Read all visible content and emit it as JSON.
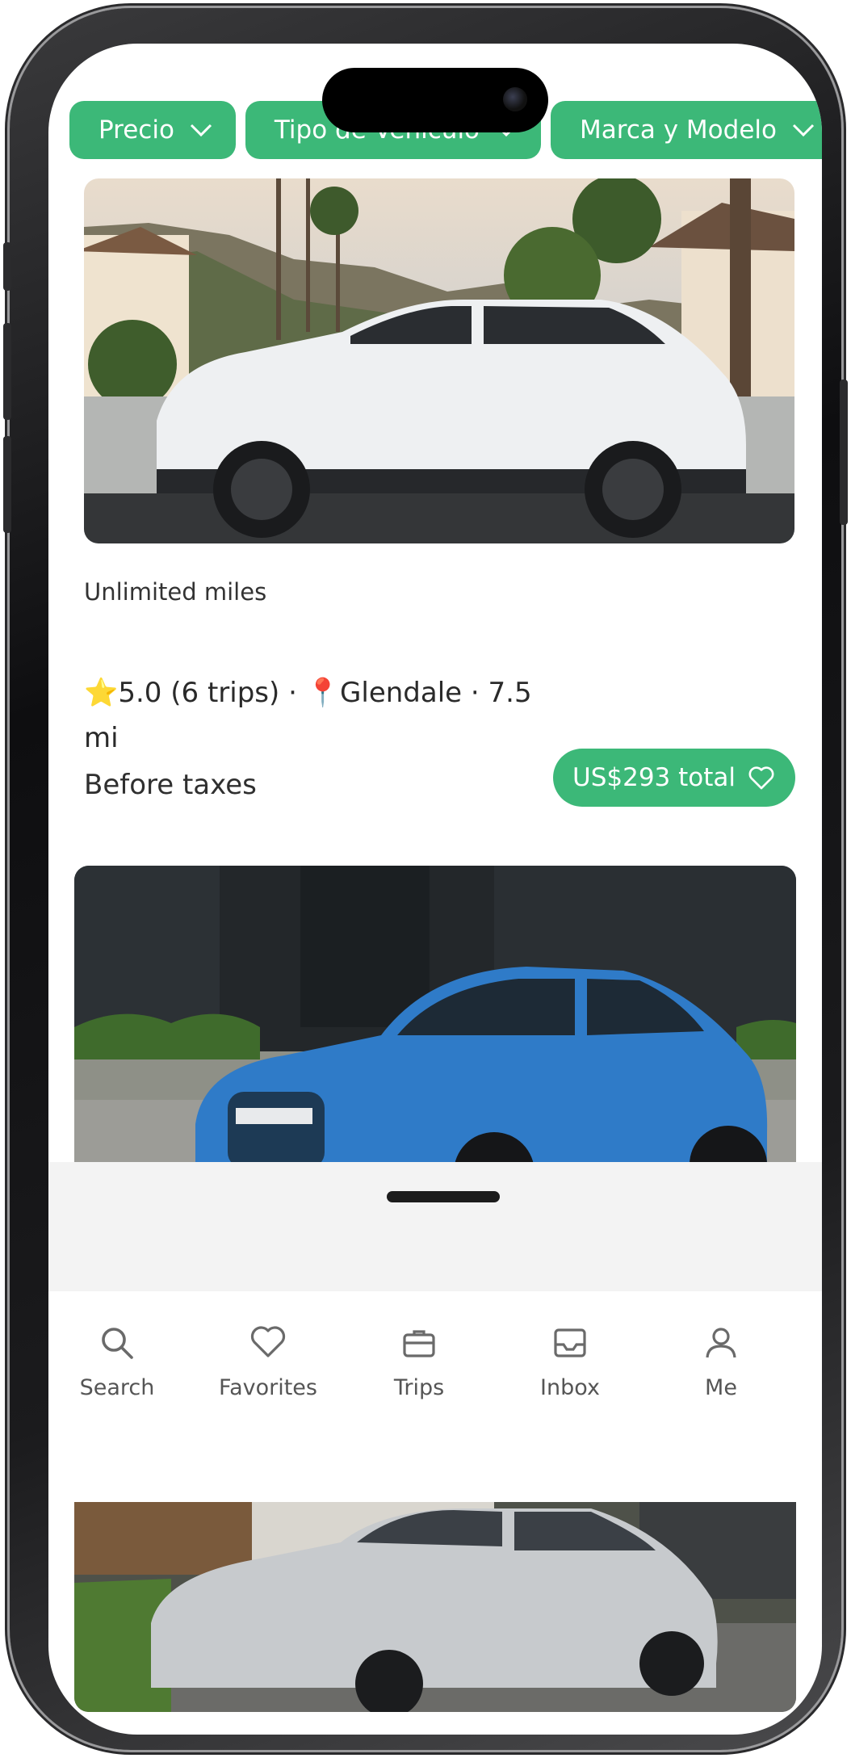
{
  "filters": [
    {
      "label": "Precio"
    },
    {
      "label": "Tipo de Vehículo"
    },
    {
      "label": "Marca y Modelo"
    }
  ],
  "listing": {
    "feature": "Unlimited miles",
    "star_emoji": "⭐",
    "rating": "5.0",
    "trips": "(6 trips)",
    "pin_emoji": "📍",
    "location": "Glendale",
    "distance": "7.5 mi",
    "tax_note": "Before taxes",
    "price": "US$293 total"
  },
  "nav": {
    "items": [
      {
        "label": "Search",
        "icon": "search-icon"
      },
      {
        "label": "Favorites",
        "icon": "heart-icon"
      },
      {
        "label": "Trips",
        "icon": "briefcase-icon"
      },
      {
        "label": "Inbox",
        "icon": "inbox-icon"
      },
      {
        "label": "Me",
        "icon": "user-icon"
      }
    ]
  },
  "colors": {
    "accent": "#3cb878",
    "text": "#2a2a2a",
    "sheet": "#f3f3f3"
  }
}
